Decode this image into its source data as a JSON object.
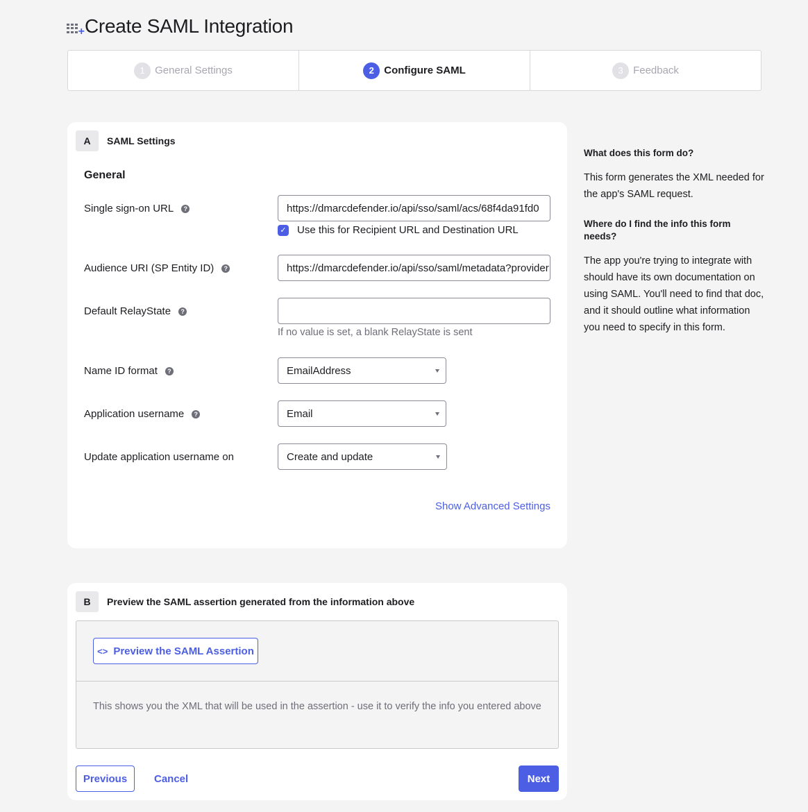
{
  "header": {
    "title": "Create SAML Integration",
    "icon": "app-grid-plus-icon"
  },
  "stepper": [
    {
      "num": "1",
      "label": "General Settings",
      "state": "completed"
    },
    {
      "num": "2",
      "label": "Configure SAML",
      "state": "active"
    },
    {
      "num": "3",
      "label": "Feedback",
      "state": "pending"
    }
  ],
  "section_a": {
    "letter": "A",
    "title": "SAML Settings",
    "group_title": "General",
    "sso_url": {
      "label": "Single sign-on URL",
      "value": "https://dmarcdefender.io/api/sso/saml/acs/68f4da91fd0",
      "checkbox_label": "Use this for Recipient URL and Destination URL",
      "checkbox_checked": true
    },
    "audience_uri": {
      "label": "Audience URI (SP Entity ID)",
      "value": "https://dmarcdefender.io/api/sso/saml/metadata?provider"
    },
    "relay_state": {
      "label": "Default RelayState",
      "value": "",
      "hint": "If no value is set, a blank RelayState is sent"
    },
    "name_id_format": {
      "label": "Name ID format",
      "selected": "EmailAddress"
    },
    "app_username": {
      "label": "Application username",
      "selected": "Email"
    },
    "update_username": {
      "label": "Update application username on",
      "selected": "Create and update"
    },
    "advanced_link": "Show Advanced Settings"
  },
  "section_b": {
    "letter": "B",
    "title": "Preview the SAML assertion generated from the information above",
    "preview_button": "Preview the SAML Assertion",
    "preview_icon": "<>",
    "description": "This shows you the XML that will be used in the assertion - use it to verify the info you entered above"
  },
  "footer": {
    "previous": "Previous",
    "cancel": "Cancel",
    "next": "Next"
  },
  "aside": {
    "q1": "What does this form do?",
    "a1": "This form generates the XML needed for the app's SAML request.",
    "q2": "Where do I find the info this form needs?",
    "a2": "The app you're trying to integrate with should have its own documentation on using SAML. You'll need to find that doc, and it should outline what information you need to specify in this form."
  },
  "colors": {
    "accent": "#4b5ee4",
    "background": "#f4f4f4",
    "muted": "#6e6e78"
  }
}
